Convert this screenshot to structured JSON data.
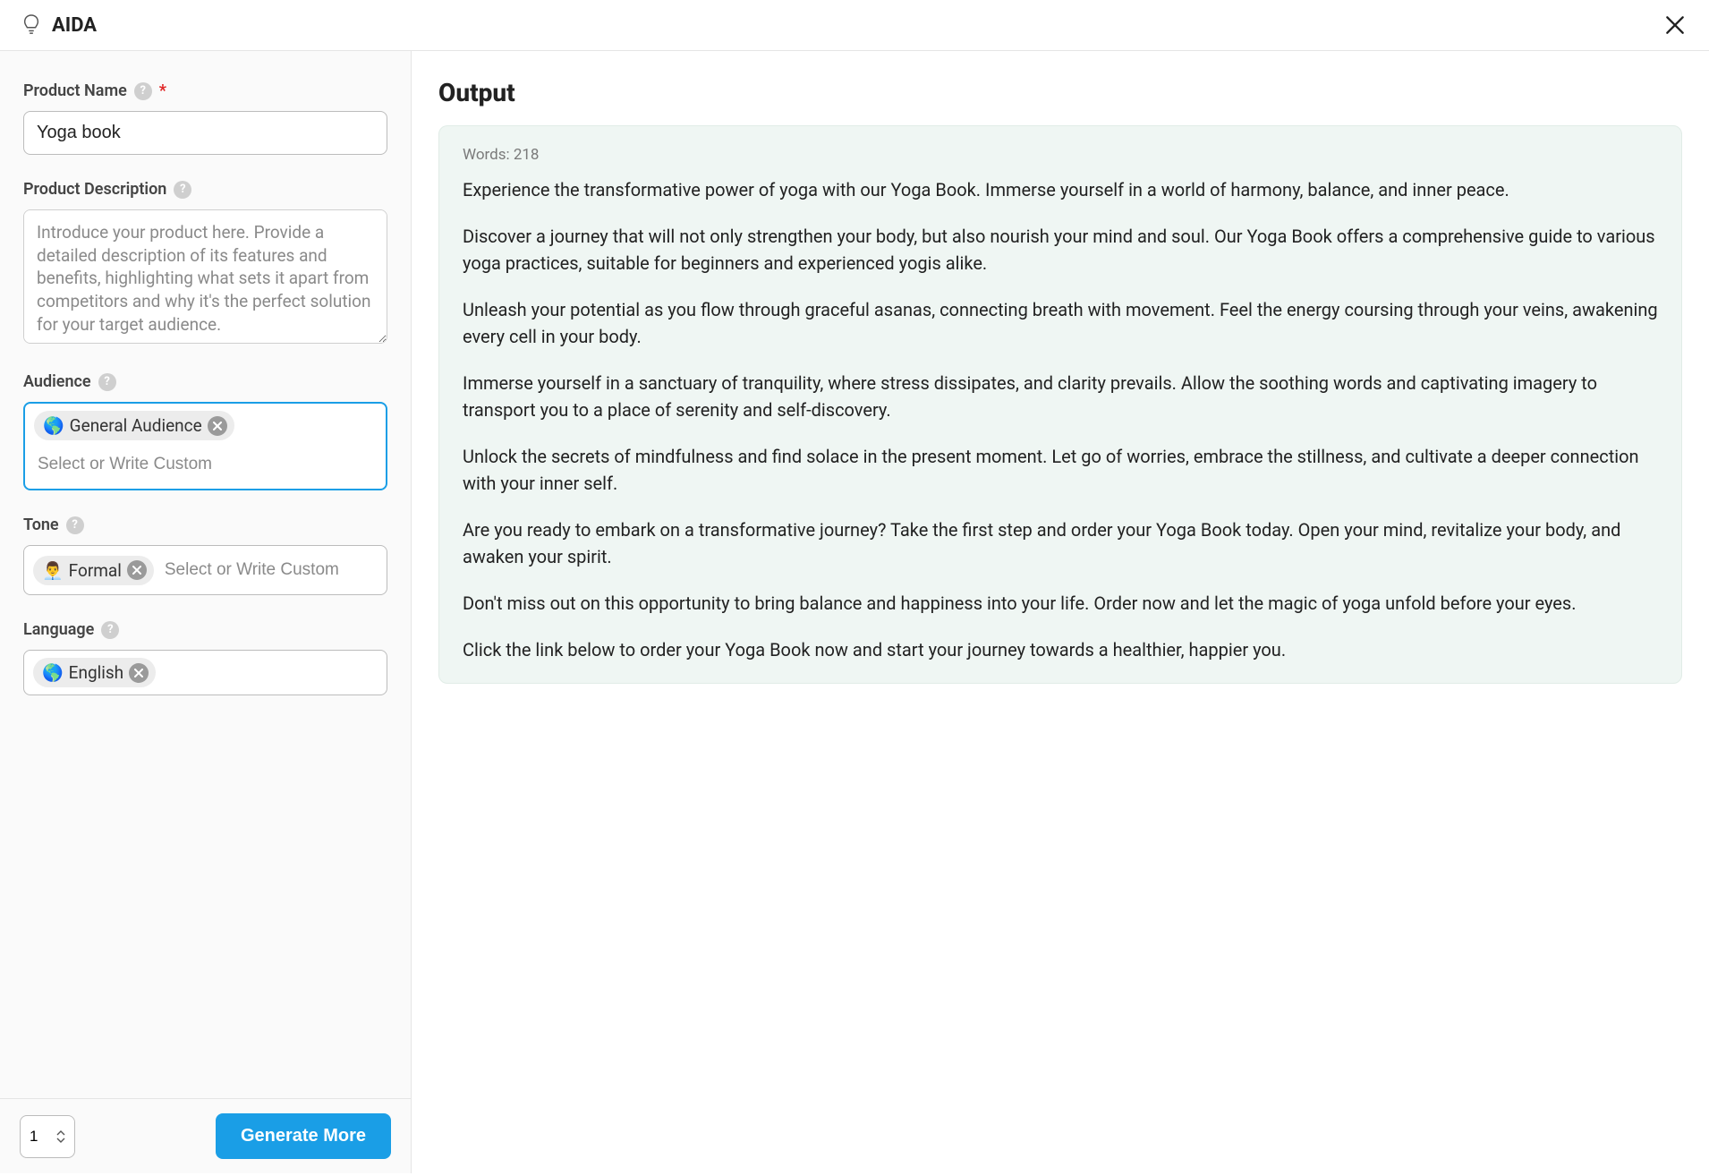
{
  "header": {
    "title": "AIDA"
  },
  "form": {
    "product_name": {
      "label": "Product Name",
      "value": "Yoga book",
      "required": true
    },
    "product_description": {
      "label": "Product Description",
      "placeholder": "Introduce your product here. Provide a detailed description of its features and benefits, highlighting what sets it apart from competitors and why it's the perfect solution for your target audience.",
      "value": ""
    },
    "audience": {
      "label": "Audience",
      "chip_emoji": "🌎",
      "chip_label": "General Audience",
      "placeholder": "Select or Write Custom"
    },
    "tone": {
      "label": "Tone",
      "chip_emoji": "👨‍💼",
      "chip_label": "Formal",
      "placeholder": "Select or Write Custom"
    },
    "language": {
      "label": "Language",
      "chip_emoji": "🌎",
      "chip_label": "English"
    },
    "quantity": {
      "value": "1"
    },
    "generate_label": "Generate More"
  },
  "output": {
    "title": "Output",
    "word_count_label": "Words:",
    "word_count_value": "218",
    "paragraphs": [
      "Experience the transformative power of yoga with our Yoga Book. Immerse yourself in a world of harmony, balance, and inner peace.",
      "Discover a journey that will not only strengthen your body, but also nourish your mind and soul. Our Yoga Book offers a comprehensive guide to various yoga practices, suitable for beginners and experienced yogis alike.",
      "Unleash your potential as you flow through graceful asanas, connecting breath with movement. Feel the energy coursing through your veins, awakening every cell in your body.",
      "Immerse yourself in a sanctuary of tranquility, where stress dissipates, and clarity prevails. Allow the soothing words and captivating imagery to transport you to a place of serenity and self-discovery.",
      "Unlock the secrets of mindfulness and find solace in the present moment. Let go of worries, embrace the stillness, and cultivate a deeper connection with your inner self.",
      "Are you ready to embark on a transformative journey? Take the first step and order your Yoga Book today. Open your mind, revitalize your body, and awaken your spirit.",
      "Don't miss out on this opportunity to bring balance and happiness into your life. Order now and let the magic of yoga unfold before your eyes.",
      "Click the link below to order your Yoga Book now and start your journey towards a healthier, happier you."
    ]
  }
}
